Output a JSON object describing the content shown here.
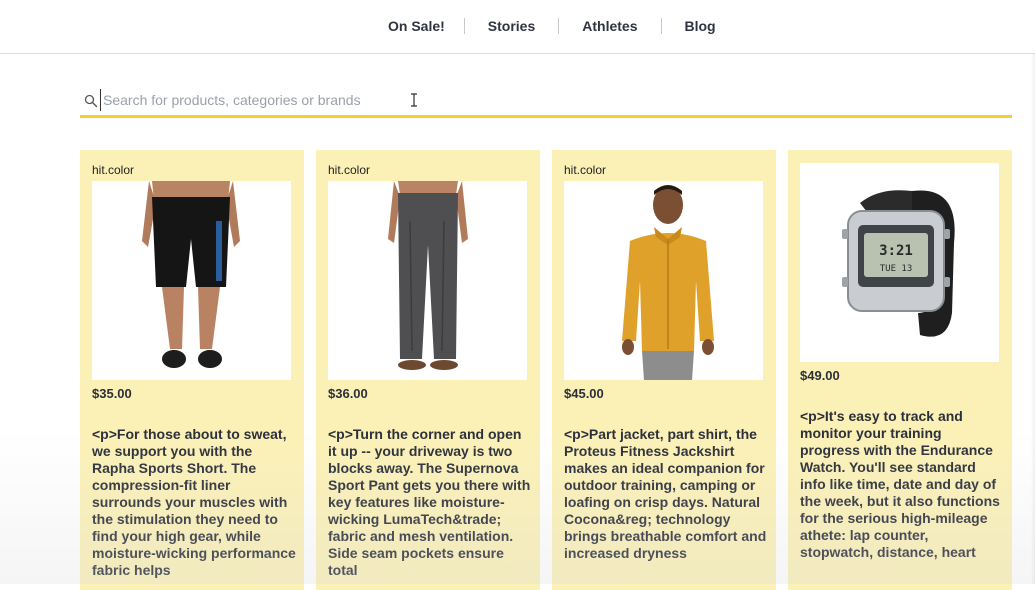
{
  "nav": {
    "items": [
      "On Sale!",
      "Stories",
      "Athletes",
      "Blog"
    ]
  },
  "search": {
    "placeholder": "Search for products, categories or brands",
    "value": ""
  },
  "products": [
    {
      "tag": "hit.color",
      "image": "black-athletic-shorts",
      "price": "$35.00",
      "description": "<p>For those about to sweat, we support you with the Rapha Sports Short. The compression-fit liner surrounds your muscles with the stimulation they need to find your high gear, while moisture-wicking performance fabric helps"
    },
    {
      "tag": "hit.color",
      "image": "gray-sport-pants",
      "price": "$36.00",
      "description": "<p>Turn the corner and open it up -- your driveway is two blocks away. The Supernova Sport Pant gets you there with key features like moisture-wicking LumaTech&trade; fabric and mesh ventilation. Side seam pockets ensure total"
    },
    {
      "tag": "hit.color",
      "image": "orange-jackshirt",
      "price": "$45.00",
      "description": "<p>Part jacket, part shirt, the Proteus Fitness Jackshirt makes an ideal companion for outdoor training, camping or loafing on crisp days. Natural Cocona&reg; technology brings breathable comfort and increased dryness"
    },
    {
      "tag": "",
      "image": "digital-sport-watch",
      "price": "$49.00",
      "description": "<p>It's easy to track and monitor your training progress with the Endurance Watch. You'll see standard info like time, date and day of the week, but it also functions for the serious high-mileage athete: lap counter, stopwatch, distance, heart"
    }
  ],
  "colors": {
    "card_bg": "#fbf1b7",
    "accent": "#f3cf2f",
    "text": "#2b2f3a"
  }
}
